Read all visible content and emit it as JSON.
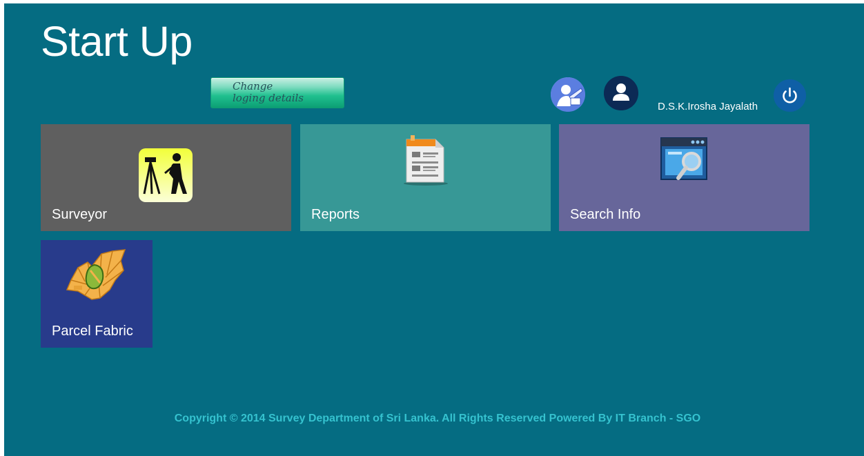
{
  "header": {
    "title": "Start Up",
    "change_login": {
      "line1": "Change",
      "line2": "loging details"
    },
    "user_name": "D.S.K.Irosha Jayalath",
    "icons": {
      "help": "help-manual-icon",
      "user": "user-profile-icon",
      "logout": "power-icon"
    }
  },
  "tiles": [
    {
      "label": "Surveyor",
      "icon": "surveyor-icon",
      "color": "#5f5f5f"
    },
    {
      "label": "Reports",
      "icon": "report-document-icon",
      "color": "#379896"
    },
    {
      "label": "Search Info",
      "icon": "magnifier-window-icon",
      "color": "#67669a"
    },
    {
      "label": "Parcel Fabric",
      "icon": "parcel-map-icon",
      "color": "#283b8b"
    }
  ],
  "footer": {
    "text": "Copyright © 2014 Survey Department of Sri Lanka. All Rights Reserved Powered By IT Branch - SGO"
  },
  "colors": {
    "background": "#056c82",
    "footer_text": "#35c2cf",
    "button_green": "#20c08f"
  }
}
